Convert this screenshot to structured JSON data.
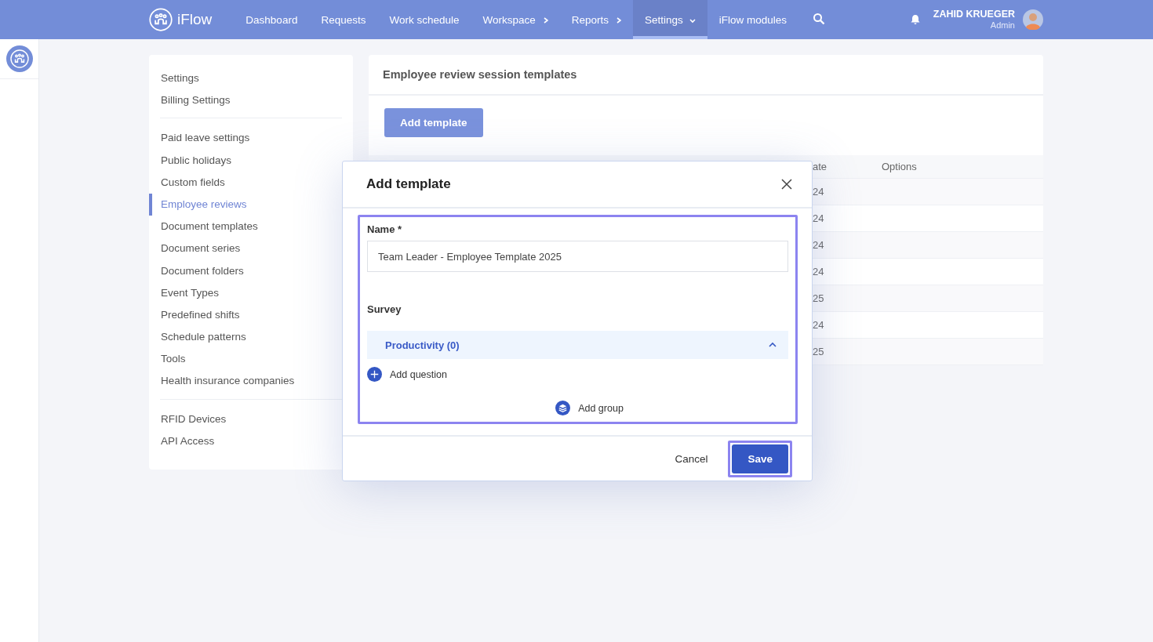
{
  "nav": {
    "brand": "iFlow",
    "items": [
      {
        "label": "Dashboard",
        "selected": false,
        "submenu": false
      },
      {
        "label": "Requests",
        "selected": false,
        "submenu": false
      },
      {
        "label": "Work schedule",
        "selected": false,
        "submenu": false
      },
      {
        "label": "Workspace",
        "selected": false,
        "submenu": true
      },
      {
        "label": "Reports",
        "selected": false,
        "submenu": true
      },
      {
        "label": "Settings",
        "selected": true,
        "submenu": true
      },
      {
        "label": "iFlow modules",
        "selected": false,
        "submenu": false
      }
    ],
    "user": {
      "name": "ZAHID KRUEGER",
      "role": "Admin"
    }
  },
  "settings_menu": {
    "groups": [
      {
        "items": [
          {
            "label": "Settings",
            "selected": false
          },
          {
            "label": "Billing Settings",
            "selected": false
          }
        ]
      },
      {
        "items": [
          {
            "label": "Paid leave settings",
            "selected": false
          },
          {
            "label": "Public holidays",
            "selected": false
          },
          {
            "label": "Custom fields",
            "selected": false
          },
          {
            "label": "Employee reviews",
            "selected": true
          },
          {
            "label": "Document templates",
            "selected": false
          },
          {
            "label": "Document series",
            "selected": false
          },
          {
            "label": "Document folders",
            "selected": false
          },
          {
            "label": "Event Types",
            "selected": false
          },
          {
            "label": "Predefined shifts",
            "selected": false
          },
          {
            "label": "Schedule patterns",
            "selected": false
          },
          {
            "label": "Tools",
            "selected": false
          },
          {
            "label": "Health insurance companies",
            "selected": false
          }
        ]
      },
      {
        "items": [
          {
            "label": "RFID Devices",
            "selected": false
          },
          {
            "label": "API Access",
            "selected": false
          }
        ]
      }
    ]
  },
  "main": {
    "title": "Employee review session templates",
    "add_button": "Add template",
    "table": {
      "columns": [
        "ate",
        "Options"
      ],
      "rows": [
        "24",
        "24",
        "24",
        "24",
        "25",
        "24",
        "25"
      ]
    }
  },
  "dialog": {
    "title": "Add template",
    "name_label": "Name *",
    "name_value": "Team Leader - Employee Template 2025",
    "survey_label": "Survey",
    "groups": [
      {
        "title": "Productivity (0)",
        "expanded": true
      }
    ],
    "add_question": "Add question",
    "add_group": "Add group",
    "cancel": "Cancel",
    "save": "Save"
  }
}
